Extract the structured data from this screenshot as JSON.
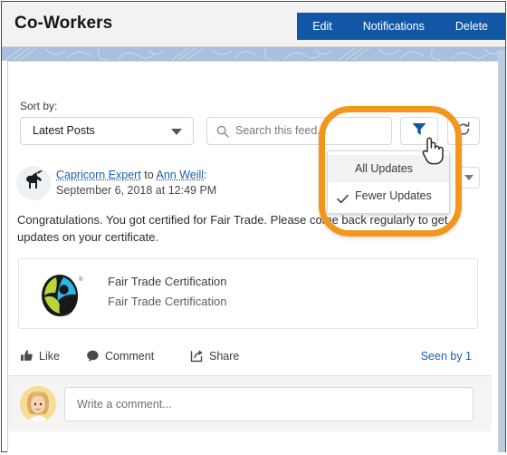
{
  "header": {
    "title": "Co-Workers",
    "buttons": [
      {
        "label": "Edit"
      },
      {
        "label": "Notifications"
      },
      {
        "label": "Delete"
      }
    ],
    "button_color": "#1257a6"
  },
  "toolbar": {
    "sort_label": "Sort by:",
    "sort_value": "Latest Posts",
    "search_placeholder": "Search this feed...",
    "filter_icon": "funnel-icon",
    "refresh_icon": "refresh-icon",
    "search_icon": "search-icon",
    "filter_color": "#1257a6"
  },
  "dropdown": {
    "open": true,
    "items": [
      {
        "label": "All Updates",
        "checked": false,
        "hovered": true
      },
      {
        "label": "Fewer Updates",
        "checked": true,
        "hovered": false
      }
    ]
  },
  "post": {
    "author": "Capricorn Expert",
    "connector": " to ",
    "recipient": "Ann Weill",
    "colon": ":",
    "date": "September 6, 2018 at 12:49 PM",
    "body": "Congratulations. You got certified for Fair Trade. Please come back regularly to get updates on your certificate.",
    "avatar_icon": "goat-avatar",
    "menu_icon": "chevron-down-icon",
    "attachment": {
      "title": "Fair Trade Certification",
      "subtitle": "Fair Trade Certification",
      "logo_icon": "fair-trade-logo"
    },
    "actions": [
      {
        "label": "Like",
        "icon": "thumbs-up-icon"
      },
      {
        "label": "Comment",
        "icon": "speech-bubble-icon"
      },
      {
        "label": "Share",
        "icon": "share-arrow-icon"
      }
    ],
    "seen_by": "Seen by 1"
  },
  "composer": {
    "placeholder": "Write a comment...",
    "avatar_icon": "woman-avatar"
  },
  "annotation": {
    "ring_color": "#f2971c",
    "cursor_icon": "pointing-hand-cursor"
  }
}
